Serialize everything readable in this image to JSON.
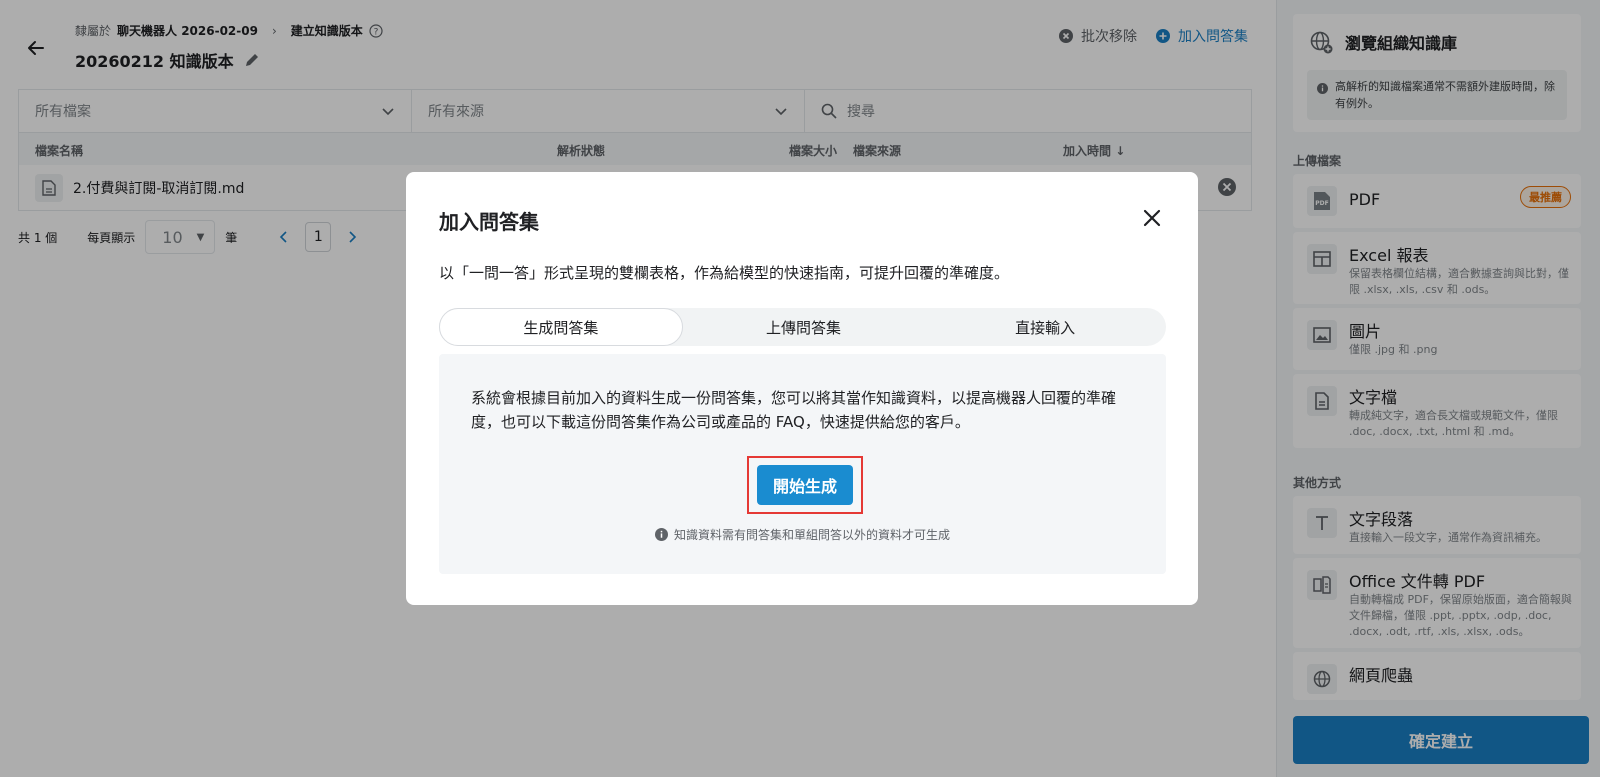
{
  "header": {
    "breadcrumb_prefix": "隸屬於",
    "breadcrumb_parent": "聊天機器人 2026-02-09",
    "breadcrumb_current": "建立知識版本",
    "title": "20260212 知識版本"
  },
  "actions": {
    "batch_remove": "批次移除",
    "add_qa": "加入問答集"
  },
  "filters": {
    "files": "所有檔案",
    "sources": "所有來源",
    "search_placeholder": "搜尋"
  },
  "table": {
    "columns": {
      "name": "檔案名稱",
      "status": "解析狀態",
      "size": "檔案大小",
      "source": "檔案來源",
      "time": "加入時間"
    },
    "rows": [
      {
        "name": "2.付費與訂閱-取消訂閱.md"
      }
    ]
  },
  "pagination": {
    "total": "共 1 個",
    "per_page_label": "每頁顯示",
    "per_page_value": "10",
    "unit": "筆",
    "current_page": "1"
  },
  "panel": {
    "browse_title": "瀏覽組織知識庫",
    "browse_note": "高解析的知識檔案通常不需額外建版時間，除有例外。",
    "upload_section": "上傳檔案",
    "other_section": "其他方式",
    "options": [
      {
        "title": "PDF",
        "desc": "",
        "badge": "最推薦",
        "icon": "pdf-icon"
      },
      {
        "title": "Excel 報表",
        "desc": "保留表格欄位結構，適合數據查詢與比對，僅限 .xlsx, .xls, .csv 和 .ods。",
        "icon": "table-icon"
      },
      {
        "title": "圖片",
        "desc": "僅限 .jpg 和 .png",
        "icon": "image-icon"
      },
      {
        "title": "文字檔",
        "desc": "轉成純文字，適合長文檔或規範文件，僅限 .doc, .docx, .txt, .html 和 .md。",
        "icon": "document-icon"
      },
      {
        "title": "文字段落",
        "desc": "直接輸入一段文字，通常作為資訊補充。",
        "icon": "text-icon"
      },
      {
        "title": "Office 文件轉 PDF",
        "desc": "自動轉檔成 PDF，保留原始版面，適合簡報與文件歸檔，僅限 .ppt, .pptx, .odp, .doc, .docx, .odt, .rtf, .xls, .xlsx, .ods。",
        "icon": "office-convert-icon"
      },
      {
        "title": "網頁爬蟲",
        "desc": "",
        "icon": "web-crawler-icon"
      }
    ],
    "confirm": "確定建立"
  },
  "modal": {
    "title": "加入問答集",
    "description": "以「一問一答」形式呈現的雙欄表格，作為給模型的快速指南，可提升回覆的準確度。",
    "tabs": [
      "生成問答集",
      "上傳問答集",
      "直接輸入"
    ],
    "active_tab": 0,
    "content": "系統會根據目前加入的資料生成一份問答集，您可以將其當作知識資料，以提高機器人回覆的準確度，也可以下載這份問答集作為公司或產品的 FAQ，快速提供給您的客戶。",
    "generate_button": "開始生成",
    "note": "知識資料需有問答集和單組問答以外的資料才可生成"
  },
  "colors": {
    "primary": "#1a7fc4",
    "highlight": "#e53935",
    "badge": "#e8710a"
  }
}
